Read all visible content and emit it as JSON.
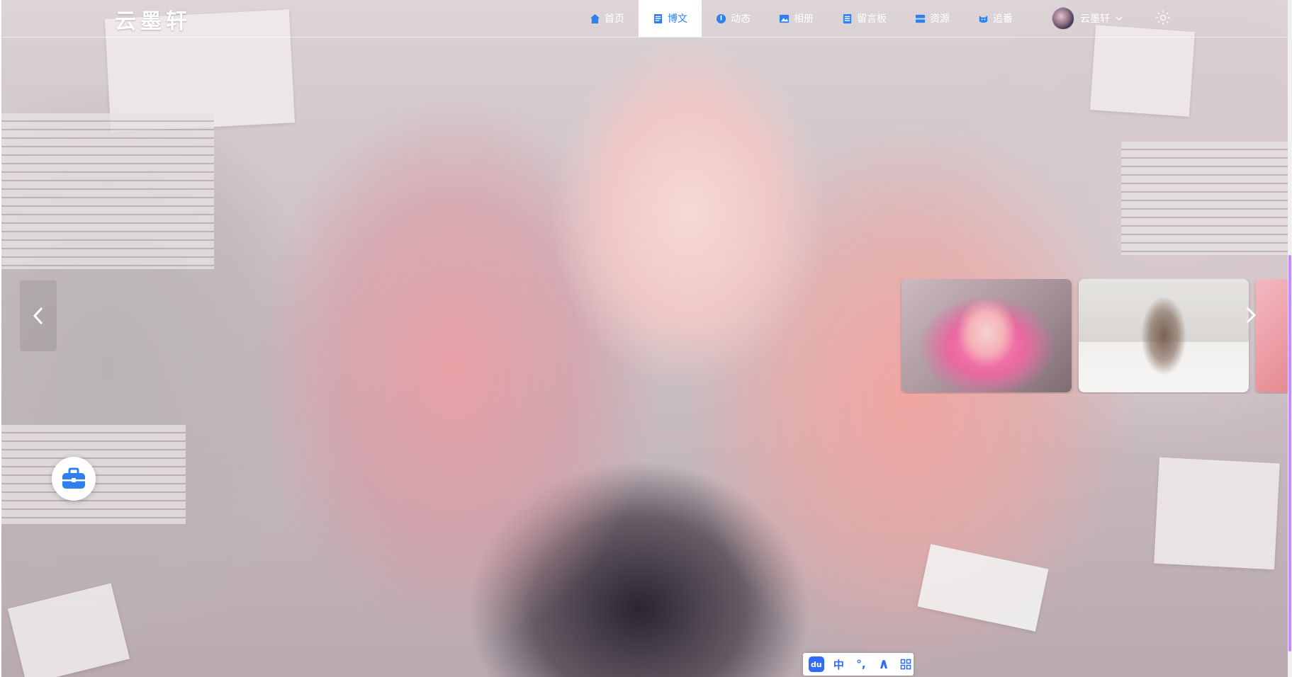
{
  "site": {
    "logo_text": "云墨轩"
  },
  "nav": {
    "items": [
      {
        "label": "首页",
        "icon": "home-icon",
        "active": false
      },
      {
        "label": "博文",
        "icon": "article-icon",
        "active": true
      },
      {
        "label": "动态",
        "icon": "moments-icon",
        "active": false
      },
      {
        "label": "相册",
        "icon": "album-icon",
        "active": false
      },
      {
        "label": "留言板",
        "icon": "message-board-icon",
        "active": false
      },
      {
        "label": "资源",
        "icon": "resources-icon",
        "active": false
      },
      {
        "label": "追番",
        "icon": "anime-icon",
        "active": false
      }
    ],
    "user": {
      "name": "云墨轩",
      "dropdown_icon": "chevron-down-icon"
    },
    "theme_icon": "sun-icon"
  },
  "carousel": {
    "prev_icon": "chevron-left-icon",
    "next_icon": "chevron-right-icon",
    "thumbnails": [
      "pink-hair-girl-thumbnail",
      "girl-sitting-room-thumbnail",
      "pink-thumbnail-partial"
    ]
  },
  "floating": {
    "toolbox_icon": "toolbox-icon"
  },
  "ime_toolbar": {
    "items": [
      {
        "label": "du",
        "icon": "ime-logo-icon"
      },
      {
        "label": "中",
        "icon": "chinese-mode-icon"
      },
      {
        "label": "°,",
        "icon": "punctuation-icon"
      },
      {
        "label": "",
        "icon": "skin-icon"
      },
      {
        "label": "",
        "icon": "grid-menu-icon"
      }
    ]
  },
  "colors": {
    "accent": "#2f80ed",
    "scrollbar": "#c58cff",
    "toolbox": "#2f80ed"
  }
}
